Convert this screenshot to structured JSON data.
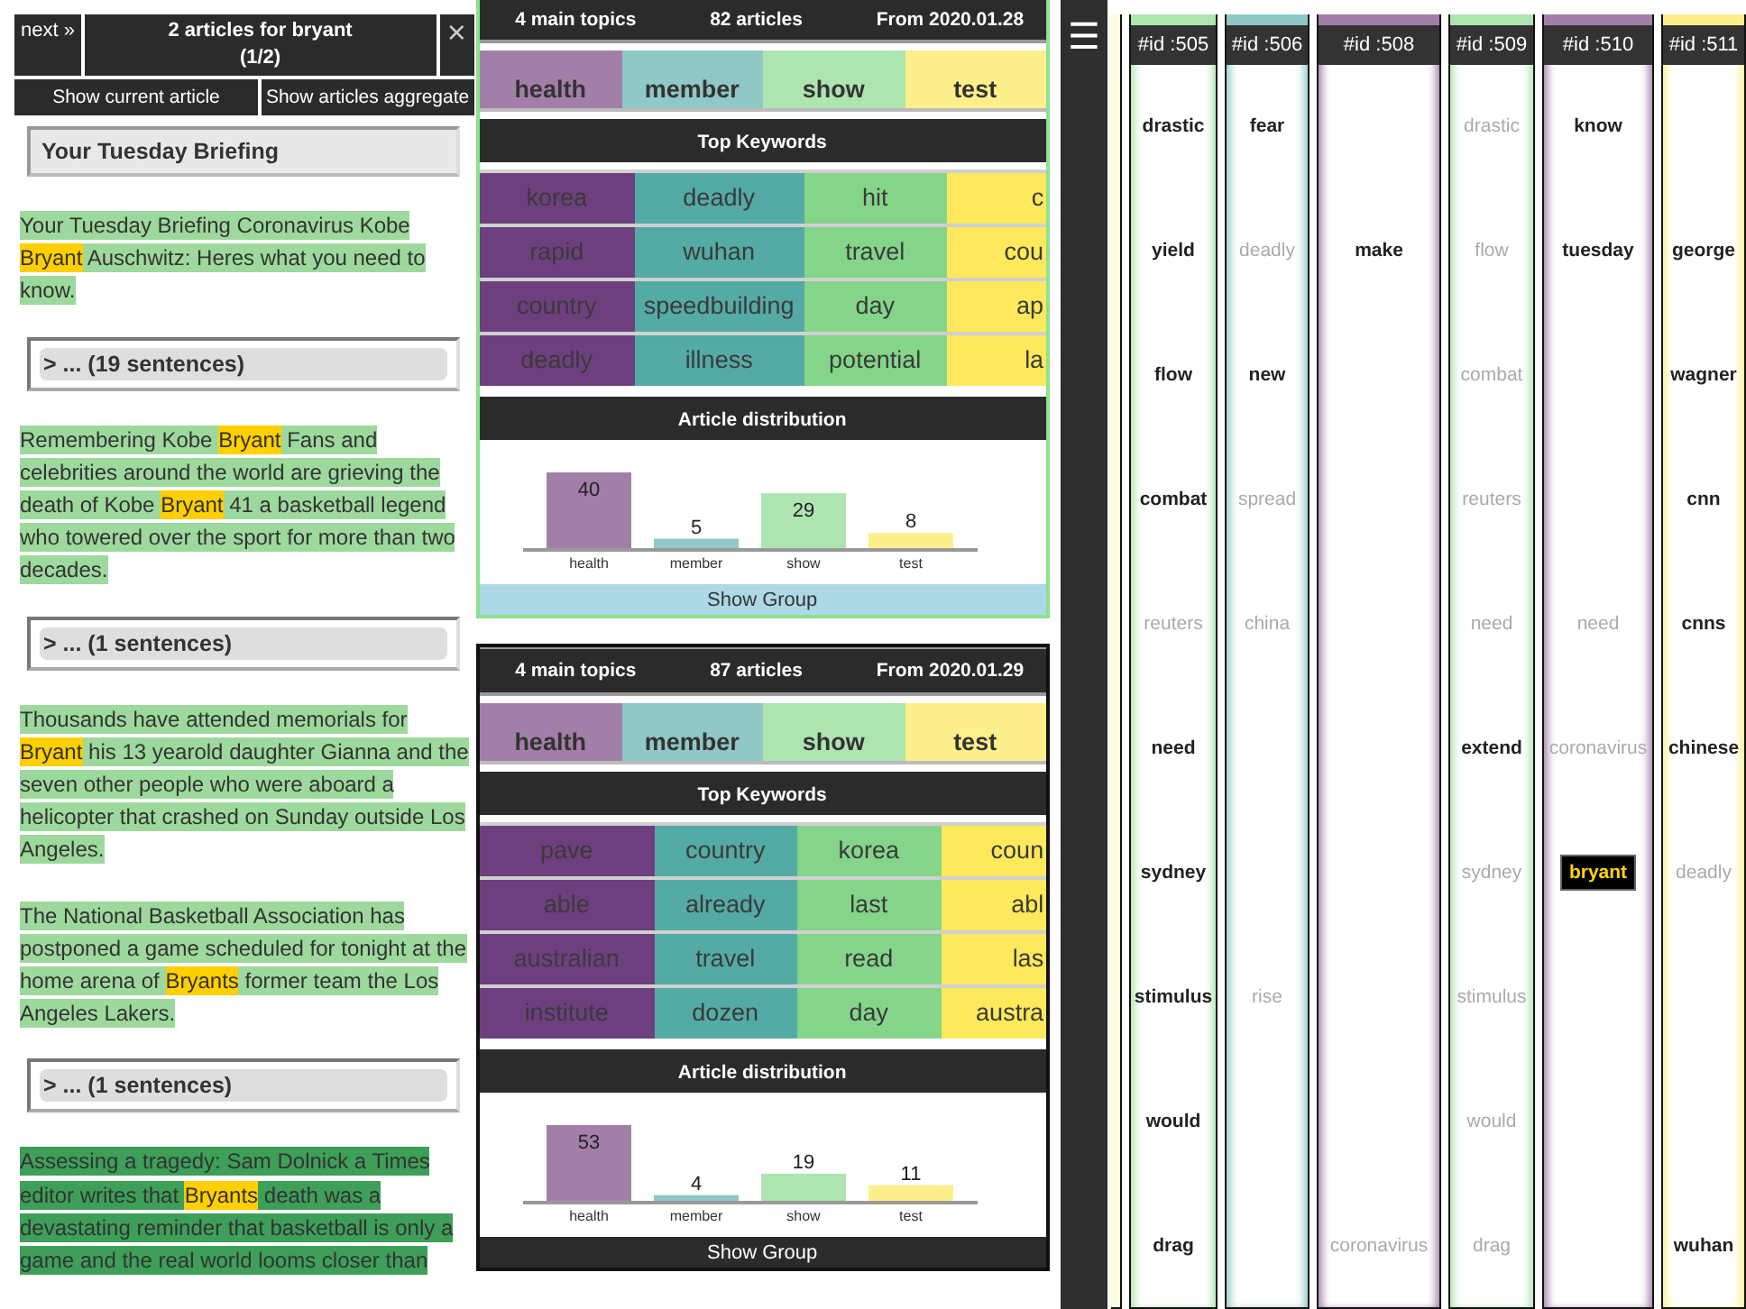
{
  "panel": {
    "next_button": "next »",
    "title": "2 articles for bryant",
    "counter": "(1/2)",
    "close_button": "×",
    "buttons": [
      "Show current article",
      "Show articles aggregate"
    ]
  },
  "article": {
    "title": "Your Tuesday Briefing",
    "items": [
      {
        "kind": "paragraph",
        "dark": false,
        "segments": [
          {
            "text": "Your Tuesday Briefing Coronavirus Kobe ",
            "highlight": false
          },
          {
            "text": "Bryant",
            "highlight": true
          },
          {
            "text": " Auschwitz: Heres what you need to know.",
            "highlight": false
          }
        ]
      },
      {
        "kind": "collapsed",
        "label": "> ... (19 sentences)"
      },
      {
        "kind": "paragraph",
        "dark": false,
        "segments": [
          {
            "text": "Remembering Kobe ",
            "highlight": false
          },
          {
            "text": "Bryant",
            "highlight": true
          },
          {
            "text": " Fans and celebrities around the world are grieving the death of Kobe ",
            "highlight": false
          },
          {
            "text": "Bryant",
            "highlight": true
          },
          {
            "text": " 41 a basketball legend who towered over the sport for more than two decades.",
            "highlight": false
          }
        ]
      },
      {
        "kind": "collapsed",
        "label": "> ... (1 sentences)"
      },
      {
        "kind": "paragraph",
        "dark": false,
        "segments": [
          {
            "text": "Thousands have attended memorials for ",
            "highlight": false
          },
          {
            "text": "Bryant",
            "highlight": true
          },
          {
            "text": " his 13 yearold daughter Gianna and the seven other people who were aboard a helicopter that crashed on Sunday outside Los Angeles.",
            "highlight": false
          }
        ]
      },
      {
        "kind": "paragraph",
        "dark": false,
        "segments": [
          {
            "text": "The National Basketball Association has postponed a game scheduled for tonight at the home arena of ",
            "highlight": false
          },
          {
            "text": "Bryants",
            "highlight": true
          },
          {
            "text": " former team the Los Angeles Lakers.",
            "highlight": false
          }
        ]
      },
      {
        "kind": "collapsed",
        "label": "> ... (1 sentences)"
      },
      {
        "kind": "paragraph",
        "dark": true,
        "segments": [
          {
            "text": "Assessing a tragedy: Sam Dolnick a Times editor writes that ",
            "highlight": false
          },
          {
            "text": "Bryants",
            "highlight": true
          },
          {
            "text": " death was a devastating reminder that basketball is only a game and the real world looms closer than",
            "highlight": false
          }
        ]
      }
    ]
  },
  "cards": [
    {
      "selected": true,
      "topic_count": "4 main topics",
      "article_count": "82 articles",
      "date": "From 2020.01.28",
      "topics": [
        {
          "name": "health",
          "color": "#a27fa8"
        },
        {
          "name": "member",
          "color": "#8fc8c5"
        },
        {
          "name": "show",
          "color": "#aee4b0"
        },
        {
          "name": "test",
          "color": "#fdf08c"
        }
      ],
      "keywords_title": "Top Keywords",
      "keyword_columns": [
        {
          "color": "#6e3f7e",
          "words": [
            "korea",
            "rapid",
            "country",
            "deadly"
          ]
        },
        {
          "color": "#54aaa5",
          "words": [
            "deadly",
            "wuhan",
            "speedbuilding",
            "illness"
          ]
        },
        {
          "color": "#84d58a",
          "words": [
            "hit",
            "travel",
            "day",
            "potential"
          ]
        },
        {
          "color": "#fde95b",
          "words": [
            "c",
            "cou",
            "ap",
            "la"
          ]
        }
      ],
      "chart_title": "Article distribution",
      "chart_data": {
        "type": "bar",
        "categories": [
          "health",
          "member",
          "show",
          "test"
        ],
        "series": [
          {
            "values": [
              40,
              5,
              29,
              8
            ]
          }
        ],
        "data_labels": true
      },
      "show_group": "Show Group"
    },
    {
      "selected": false,
      "topic_count": "4 main topics",
      "article_count": "87 articles",
      "date": "From 2020.01.29",
      "topics": [
        {
          "name": "health",
          "color": "#a27fa8"
        },
        {
          "name": "member",
          "color": "#8fc8c5"
        },
        {
          "name": "show",
          "color": "#aee4b0"
        },
        {
          "name": "test",
          "color": "#fdf08c"
        }
      ],
      "keywords_title": "Top Keywords",
      "keyword_columns": [
        {
          "color": "#6e3f7e",
          "words": [
            "pave",
            "able",
            "australian",
            "institute"
          ]
        },
        {
          "color": "#54aaa5",
          "words": [
            "country",
            "already",
            "travel",
            "dozen"
          ]
        },
        {
          "color": "#84d58a",
          "words": [
            "korea",
            "last",
            "read",
            "day"
          ]
        },
        {
          "color": "#fde95b",
          "words": [
            "coun",
            "abl",
            "las",
            "austra"
          ]
        }
      ],
      "chart_title": "Article distribution",
      "chart_data": {
        "type": "bar",
        "categories": [
          "health",
          "member",
          "show",
          "test"
        ],
        "series": [
          {
            "values": [
              53,
              4,
              19,
              11
            ]
          }
        ],
        "data_labels": true
      },
      "show_group": "Show Group"
    }
  ],
  "menu_button": "☰",
  "columns": [
    {
      "header": "#id :505",
      "color": "#aee4b0",
      "words": [
        {
          "text": "drastic",
          "kind": "strong"
        },
        {
          "text": "yield",
          "kind": "strong"
        },
        {
          "text": "flow",
          "kind": "strong"
        },
        {
          "text": "combat",
          "kind": "strong"
        },
        {
          "text": "reuters",
          "kind": "faint"
        },
        {
          "text": "need",
          "kind": "strong"
        },
        {
          "text": "sydney",
          "kind": "strong"
        },
        {
          "text": "stimulus",
          "kind": "strong"
        },
        {
          "text": "would",
          "kind": "strong"
        },
        {
          "text": "drag",
          "kind": "strong"
        }
      ]
    },
    {
      "header": "#id :506",
      "color": "#8fc8c5",
      "words": [
        {
          "text": "fear",
          "kind": "strong"
        },
        {
          "text": "deadly",
          "kind": "faint"
        },
        {
          "text": "new",
          "kind": "strong"
        },
        {
          "text": "spread",
          "kind": "faint"
        },
        {
          "text": "china",
          "kind": "faint"
        },
        {
          "kind": "empty"
        },
        {
          "kind": "empty"
        },
        {
          "text": "rise",
          "kind": "faint"
        },
        {
          "kind": "empty"
        },
        {
          "kind": "empty"
        }
      ]
    },
    {
      "header": "#id :508",
      "color": "#a27fa8",
      "words": [
        {
          "kind": "empty"
        },
        {
          "text": "make",
          "kind": "strong"
        },
        {
          "kind": "empty"
        },
        {
          "kind": "empty"
        },
        {
          "kind": "empty"
        },
        {
          "kind": "empty"
        },
        {
          "kind": "empty"
        },
        {
          "kind": "empty"
        },
        {
          "kind": "empty"
        },
        {
          "text": "coronavirus",
          "kind": "faint"
        }
      ]
    },
    {
      "header": "#id :509",
      "color": "#aee4b0",
      "words": [
        {
          "text": "drastic",
          "kind": "faint"
        },
        {
          "text": "flow",
          "kind": "faint"
        },
        {
          "text": "combat",
          "kind": "faint"
        },
        {
          "text": "reuters",
          "kind": "faint"
        },
        {
          "text": "need",
          "kind": "faint"
        },
        {
          "text": "extend",
          "kind": "strong"
        },
        {
          "text": "sydney",
          "kind": "faint"
        },
        {
          "text": "stimulus",
          "kind": "faint"
        },
        {
          "text": "would",
          "kind": "faint"
        },
        {
          "text": "drag",
          "kind": "faint"
        }
      ]
    },
    {
      "header": "#id :510",
      "color": "#a27fa8",
      "words": [
        {
          "text": "know",
          "kind": "strong"
        },
        {
          "text": "tuesday",
          "kind": "strong"
        },
        {
          "kind": "empty"
        },
        {
          "kind": "empty"
        },
        {
          "text": "need",
          "kind": "faint"
        },
        {
          "text": "coronavirus",
          "kind": "faint"
        },
        {
          "text": "bryant",
          "kind": "highlight"
        },
        {
          "kind": "empty"
        },
        {
          "kind": "empty"
        },
        {
          "kind": "empty"
        }
      ]
    },
    {
      "header": "#id :511",
      "color": "#fdf08c",
      "words": [
        {
          "kind": "empty"
        },
        {
          "text": "george",
          "kind": "strong"
        },
        {
          "text": "wagner",
          "kind": "strong"
        },
        {
          "text": "cnn",
          "kind": "strong"
        },
        {
          "text": "cnns",
          "kind": "strong"
        },
        {
          "text": "chinese",
          "kind": "strong"
        },
        {
          "text": "deadly",
          "kind": "faint"
        },
        {
          "kind": "empty"
        },
        {
          "kind": "empty"
        },
        {
          "text": "wuhan",
          "kind": "strong"
        }
      ]
    }
  ]
}
